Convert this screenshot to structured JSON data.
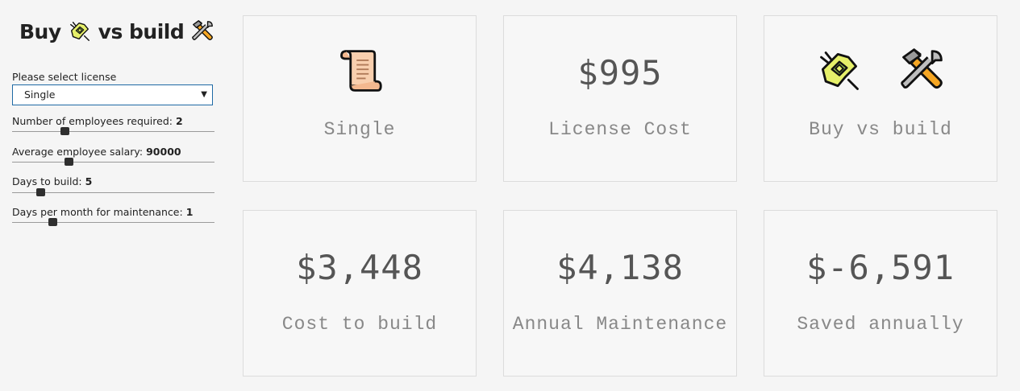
{
  "app": {
    "title_part1": "Buy",
    "title_part2": "vs build",
    "title_icon1": "plug-icon",
    "title_icon2": "hammer-wrench-icon"
  },
  "form": {
    "license_label": "Please select license",
    "license_value": "Single",
    "sliders": [
      {
        "label": "Number of employees required: ",
        "value": "2",
        "level": 0.26
      },
      {
        "label": "Average employee salary: ",
        "value": "90000",
        "level": 0.28
      },
      {
        "label": "Days to build: ",
        "value": "5",
        "level": 0.14
      },
      {
        "label": "Days per month for maintenance: ",
        "value": "1",
        "level": 0.2
      }
    ]
  },
  "cards": {
    "license_type": {
      "icon": "scroll-icon",
      "caption": "Single"
    },
    "license_cost": {
      "value": "$995",
      "caption": "License Cost"
    },
    "buy_vs_build": {
      "icon1": "plug-icon",
      "icon2": "hammer-wrench-icon",
      "caption": "Buy vs build"
    },
    "cost_to_build": {
      "value": "$3,448",
      "caption": "Cost to build"
    },
    "annual_maintenance": {
      "value": "$4,138",
      "caption": "Annual Maintenance"
    },
    "saved_annually": {
      "value": "$-6,591",
      "caption": "Saved annually"
    }
  }
}
